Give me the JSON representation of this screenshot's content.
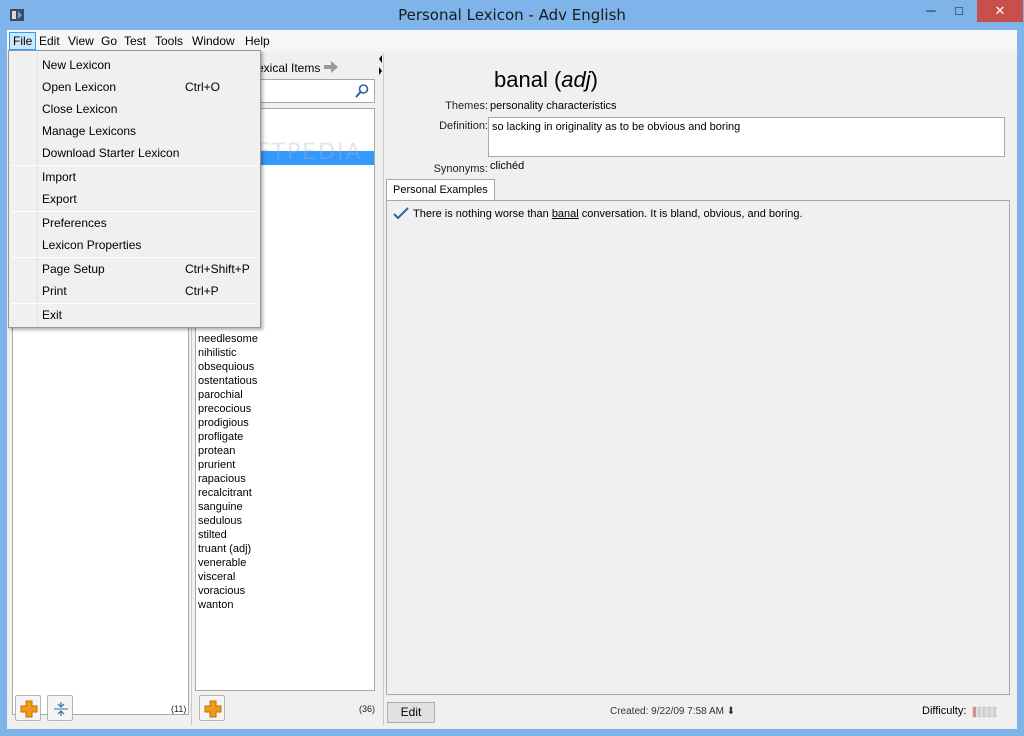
{
  "window": {
    "title": "Personal Lexicon - Adv English",
    "minimize": "─",
    "maximize": "□",
    "close": "✕"
  },
  "menubar": [
    "File",
    "Edit",
    "View",
    "Go",
    "Test",
    "Tools",
    "Window",
    "Help"
  ],
  "file_menu": {
    "items": [
      {
        "label": "New Lexicon",
        "shortcut": ""
      },
      {
        "label": "Open Lexicon",
        "shortcut": "Ctrl+O"
      },
      {
        "label": "Close Lexicon",
        "shortcut": ""
      },
      {
        "label": "Manage Lexicons",
        "shortcut": ""
      },
      {
        "label": "Download Starter Lexicon",
        "shortcut": ""
      },
      {
        "label": "Import",
        "shortcut": ""
      },
      {
        "label": "Export",
        "shortcut": ""
      },
      {
        "label": "Preferences",
        "shortcut": ""
      },
      {
        "label": "Lexicon Properties",
        "shortcut": ""
      },
      {
        "label": "Page Setup",
        "shortcut": "Ctrl+Shift+P"
      },
      {
        "label": "Print",
        "shortcut": "Ctrl+P"
      },
      {
        "label": "Exit",
        "shortcut": ""
      }
    ]
  },
  "left_panel": {
    "count": "(11)"
  },
  "mid_panel": {
    "header": "exical Items",
    "count": "(36)",
    "words": [
      "needlesome",
      "nihilistic",
      "obsequious",
      "ostentatious",
      "parochial",
      "precocious",
      "prodigious",
      "profligate",
      "protean",
      "prurient",
      "rapacious",
      "recalcitrant",
      "sanguine",
      "sedulous",
      "stilted",
      "truant (adj)",
      "venerable",
      "visceral",
      "voracious",
      "wanton"
    ]
  },
  "detail": {
    "word": "banal",
    "pos": "adj",
    "themes_label": "Themes:",
    "themes": "personality characteristics",
    "definition_label": "Definition:",
    "definition": "so lacking in originality as to be obvious and boring",
    "synonyms_label": "Synonyms:",
    "synonyms": "clichéd",
    "tab": "Personal Examples",
    "example_before": "There is nothing worse than ",
    "example_word": "banal",
    "example_after": " conversation. It is bland, obvious, and boring.",
    "edit_button": "Edit",
    "created": "Created:  9/22/09 7:58 AM ⬇",
    "difficulty_label": "Difficulty:",
    "difficulty_level": 1,
    "difficulty_max": 5
  },
  "watermark": "SOFTPEDIA",
  "colors": {
    "titlebar": "#7eb4ea",
    "selection": "#3399ff",
    "plus_orange": "#f39a1e"
  }
}
